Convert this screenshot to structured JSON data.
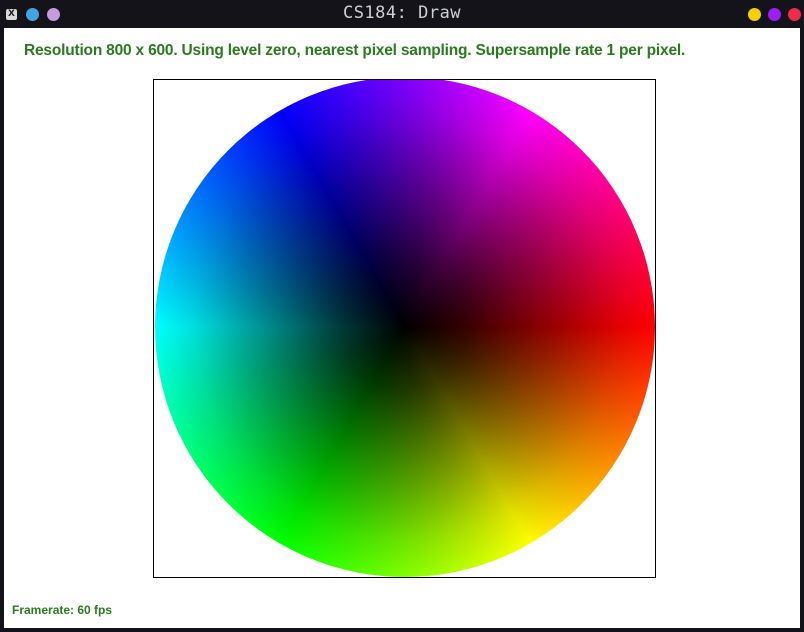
{
  "window": {
    "title": "CS184: Draw",
    "app_icon_glyph": "X",
    "left_dots": [
      {
        "name": "window-dot-blue",
        "color": "#3fa7e0"
      },
      {
        "name": "window-dot-lilac",
        "color": "#c79be0"
      }
    ],
    "right_dots": [
      {
        "name": "minimize-button",
        "color": "#f5d000"
      },
      {
        "name": "maximize-button",
        "color": "#9b1ef5"
      },
      {
        "name": "close-button",
        "color": "#f02a4a"
      }
    ]
  },
  "status": {
    "text": "Resolution 800 x 600. Using level zero, nearest pixel sampling. Supersample rate 1 per pixel."
  },
  "footer": {
    "framerate": "Framerate: 60 fps"
  },
  "canvas": {
    "content": "color-wheel",
    "icon": "hue-wheel-image"
  },
  "colors": {
    "text_green": "#2a7a1e",
    "titlebar": "#131319",
    "frame_border": "#000000"
  }
}
